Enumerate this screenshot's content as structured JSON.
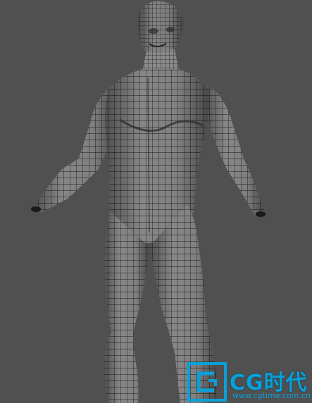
{
  "viewport": {
    "background": "#505050",
    "mesh_fill": "#9a9a9a",
    "mesh_line": "#1a1a1a",
    "subject": "wireframe-human-male-mesh"
  },
  "watermark": {
    "brand": "CG时代",
    "url": "www.cgtime.com.cn",
    "logo_icon": "cgtime-logo-icon",
    "color": "#0aa0d8"
  }
}
